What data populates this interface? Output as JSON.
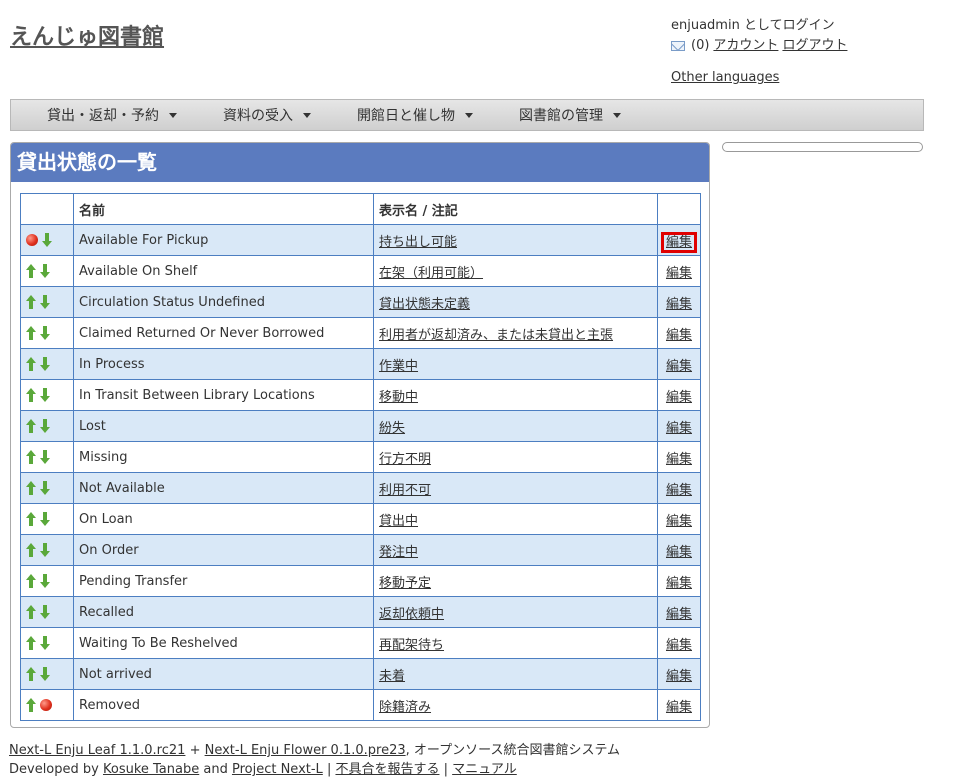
{
  "site": {
    "title": "えんじゅ図書館"
  },
  "login": {
    "status": "enjuadmin としてログイン",
    "mail_count": "(0)",
    "account": "アカウント",
    "logout": "ログアウト",
    "other_languages": "Other languages"
  },
  "nav": {
    "items": [
      {
        "label": "貸出・返却・予約"
      },
      {
        "label": "資料の受入"
      },
      {
        "label": "開館日と催し物"
      },
      {
        "label": "図書館の管理"
      }
    ]
  },
  "main": {
    "heading": "貸出状態の一覧",
    "columns": {
      "name": "名前",
      "display_name": "表示名 / 注記"
    },
    "edit_label": "編集",
    "rows": [
      {
        "name": "Available For Pickup",
        "display": "持ち出し可能",
        "icons": [
          "red-dot-icon",
          "arrow-down-icon"
        ],
        "highlighted": true
      },
      {
        "name": "Available On Shelf",
        "display": "在架（利用可能）",
        "icons": [
          "arrow-up-icon",
          "arrow-down-icon"
        ]
      },
      {
        "name": "Circulation Status Undefined",
        "display": "貸出状態未定義",
        "icons": [
          "arrow-up-icon",
          "arrow-down-icon"
        ]
      },
      {
        "name": "Claimed Returned Or Never Borrowed",
        "display": "利用者が返却済み、または未貸出と主張",
        "icons": [
          "arrow-up-icon",
          "arrow-down-icon"
        ]
      },
      {
        "name": "In Process",
        "display": "作業中",
        "icons": [
          "arrow-up-icon",
          "arrow-down-icon"
        ]
      },
      {
        "name": "In Transit Between Library Locations",
        "display": "移動中",
        "icons": [
          "arrow-up-icon",
          "arrow-down-icon"
        ]
      },
      {
        "name": "Lost",
        "display": "紛失",
        "icons": [
          "arrow-up-icon",
          "arrow-down-icon"
        ]
      },
      {
        "name": "Missing",
        "display": "行方不明",
        "icons": [
          "arrow-up-icon",
          "arrow-down-icon"
        ]
      },
      {
        "name": "Not Available",
        "display": "利用不可",
        "icons": [
          "arrow-up-icon",
          "arrow-down-icon"
        ]
      },
      {
        "name": "On Loan",
        "display": "貸出中",
        "icons": [
          "arrow-up-icon",
          "arrow-down-icon"
        ]
      },
      {
        "name": "On Order",
        "display": "発注中",
        "icons": [
          "arrow-up-icon",
          "arrow-down-icon"
        ]
      },
      {
        "name": "Pending Transfer",
        "display": "移動予定",
        "icons": [
          "arrow-up-icon",
          "arrow-down-icon"
        ]
      },
      {
        "name": "Recalled",
        "display": "返却依頼中",
        "icons": [
          "arrow-up-icon",
          "arrow-down-icon"
        ]
      },
      {
        "name": "Waiting To Be Reshelved",
        "display": "再配架待ち",
        "icons": [
          "arrow-up-icon",
          "arrow-down-icon"
        ]
      },
      {
        "name": "Not arrived",
        "display": "未着",
        "icons": [
          "arrow-up-icon",
          "arrow-down-icon"
        ]
      },
      {
        "name": "Removed",
        "display": "除籍済み",
        "icons": [
          "arrow-up-icon",
          "red-dot-icon"
        ]
      }
    ]
  },
  "footer": {
    "leaf": "Next-L Enju Leaf 1.1.0.rc21",
    "plus": " + ",
    "flower": "Next-L Enju Flower 0.1.0.pre23",
    "tagline": ", オープンソース統合図書館システム",
    "developed_by": "Developed by ",
    "kosuke": "Kosuke Tanabe",
    "and": " and ",
    "project": "Project Next-L",
    "sep1": " | ",
    "report": "不具合を報告する",
    "sep2": " | ",
    "manual": "マニュアル"
  },
  "colors": {
    "header": "#5b7bbf",
    "row_alt": "#d9e8f7",
    "border": "#4c7ec1",
    "highlight": "#e00000"
  }
}
